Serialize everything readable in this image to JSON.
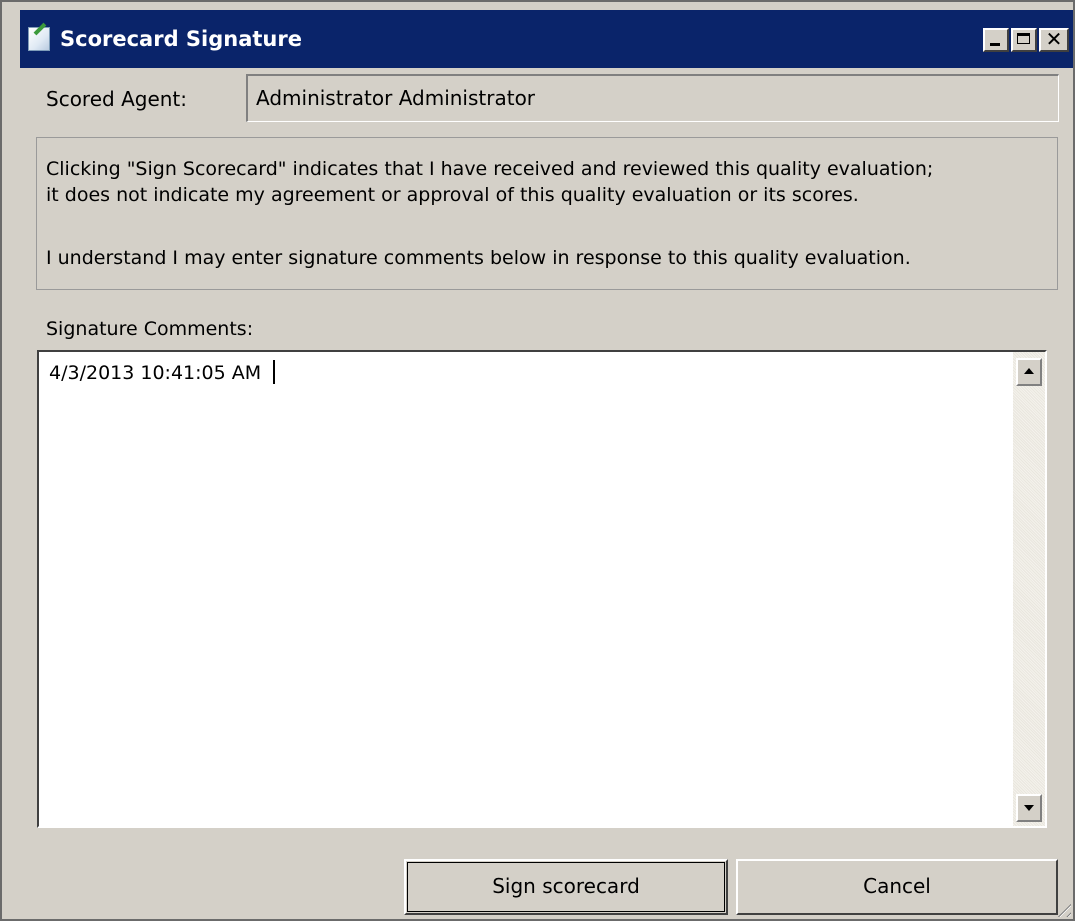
{
  "window": {
    "title": "Scorecard Signature",
    "title_icon": "scorecard-edit-icon",
    "close_glyph": "✕"
  },
  "agent": {
    "label": "Scored Agent:",
    "value": "Administrator Administrator"
  },
  "notice": {
    "line1": "Clicking \"Sign Scorecard\" indicates that I have received and reviewed this quality evaluation;",
    "line1b": "it does not indicate my agreement or approval of this quality evaluation or its scores.",
    "line2": "I understand I may enter signature comments below in response to this quality evaluation."
  },
  "comments": {
    "label": "Signature Comments:",
    "value": "4/3/2013 10:41:05 AM"
  },
  "buttons": {
    "sign_label": "Sign scorecard",
    "cancel_label": "Cancel"
  },
  "colors": {
    "titlebar": "#0a246a",
    "face": "#d4d0c8"
  }
}
